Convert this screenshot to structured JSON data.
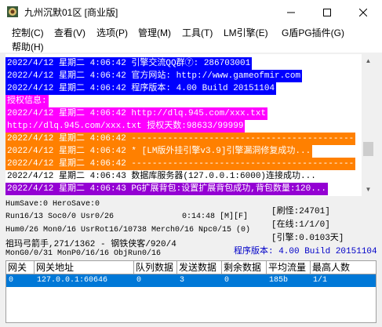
{
  "window": {
    "title": "九州沉默01区 [商业版]",
    "min_glyph": "—",
    "max_glyph": "☐",
    "close_glyph": "✕"
  },
  "menu": {
    "items": [
      {
        "label": "控制(C)"
      },
      {
        "label": "查看(V)"
      },
      {
        "label": "选项(P)"
      },
      {
        "label": "管理(M)"
      },
      {
        "label": "工具(T)"
      },
      {
        "label": "LM引擎(E)"
      },
      {
        "label": "G盾PG插件(G)"
      },
      {
        "label": "帮助(H)"
      }
    ]
  },
  "log": {
    "lines": [
      {
        "text": "2022/4/12 星期二 4:06:42 引擎交流QQ群⑦: 286703001",
        "fg": "#ffffff",
        "bg": "#0000ff"
      },
      {
        "text": "2022/4/12 星期二 4:06:42 官方网站: http://www.gameofmir.com",
        "fg": "#ffffff",
        "bg": "#0000ff"
      },
      {
        "text": "2022/4/12 星期二 4:06:42 程序版本: 4.00 Build 20151104",
        "fg": "#ffffff",
        "bg": "#0000ff"
      },
      {
        "text": "授权信息:",
        "fg": "#ffffff",
        "bg": "#ff00ff"
      },
      {
        "text": "2022/4/12 星期二 4:06:42 http://dlq.945.com/xxx.txt",
        "fg": "#ffffff",
        "bg": "#ff00ff"
      },
      {
        "text": "http://dlq.945.com/xxx.txt 授权天数:98633/99999",
        "fg": "#ffffff",
        "bg": "#ff00ff"
      },
      {
        "text": "2022/4/12 星期二 4:06:42 -------------------------------------------",
        "fg": "#ffffff",
        "bg": "#ff8000"
      },
      {
        "text": "2022/4/12 星期二 4:06:42 * [LM版外挂引擎v3.9]引擎漏洞修复成功...",
        "fg": "#ffffff",
        "bg": "#ff8000"
      },
      {
        "text": "2022/4/12 星期二 4:06:42 -------------------------------------------",
        "fg": "#ffffff",
        "bg": "#ff8000"
      },
      {
        "text": "2022/4/12 星期二 4:06:43 数据库服务器(127.0.0.1:6000)连接成功...",
        "fg": "#000000",
        "bg": "#ffffff"
      },
      {
        "text": "2022/4/12 星期二 4:06:43 PG扩展背包:设置扩展背包成功,背包数量:120...",
        "fg": "#ffffff",
        "bg": "#9400d3"
      }
    ]
  },
  "status": {
    "line1": "HumSave:0 HeroSave:0",
    "line2": "Run16/13 Soc0/0 Usr0/26",
    "time": "0:14:48 [M][F]",
    "refresh": "[刷怪:24701]",
    "online": "[在线:1/1/0]",
    "engine": "[引擎:0.0103天]",
    "line3": "Hum0/26 Mon0/16 UsrRot16/10738 Merch0/16 Npc0/15 (0)",
    "line4": "祖玛弓箭手,271/1362 - 钢铁侠客/920/4",
    "line5": "MonG0/0/31 MonP0/16/16 ObjRun0/16",
    "version": "程序版本: 4.00 Build 20151104"
  },
  "table": {
    "headers": [
      "网关",
      "网关地址",
      "队列数据",
      "发送数据",
      "剩余数据",
      "平均流量",
      "最高人数"
    ],
    "rows": [
      [
        "0",
        "127.0.0.1:60646",
        "0",
        "3",
        "0",
        "185b",
        "1/1"
      ]
    ]
  },
  "colors": {
    "selection": "#0078d7",
    "version_text": "#0000c8"
  }
}
